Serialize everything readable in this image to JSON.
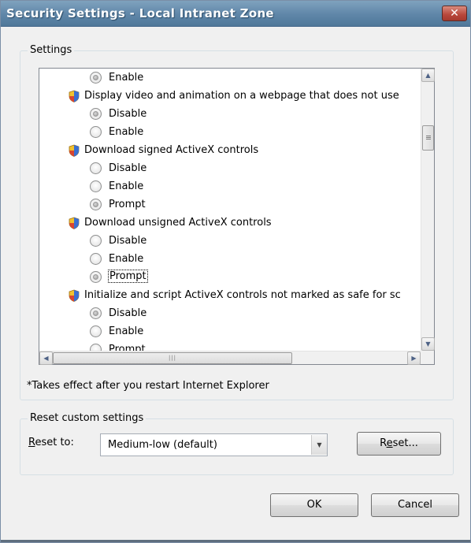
{
  "window": {
    "title": "Security Settings - Local Intranet Zone",
    "close_label": "✕"
  },
  "settings_group": {
    "legend": "Settings",
    "items": [
      {
        "kind": "option",
        "label": "Enable",
        "checked": true
      },
      {
        "kind": "header",
        "label": "Display video and animation on a webpage that does not use"
      },
      {
        "kind": "option",
        "label": "Disable",
        "checked": true
      },
      {
        "kind": "option",
        "label": "Enable",
        "checked": false
      },
      {
        "kind": "header",
        "label": "Download signed ActiveX controls"
      },
      {
        "kind": "option",
        "label": "Disable",
        "checked": false
      },
      {
        "kind": "option",
        "label": "Enable",
        "checked": false
      },
      {
        "kind": "option",
        "label": "Prompt",
        "checked": true
      },
      {
        "kind": "header",
        "label": "Download unsigned ActiveX controls"
      },
      {
        "kind": "option",
        "label": "Disable",
        "checked": false
      },
      {
        "kind": "option",
        "label": "Enable",
        "checked": false
      },
      {
        "kind": "option",
        "label": "Prompt",
        "checked": true,
        "focused": true
      },
      {
        "kind": "header",
        "label": "Initialize and script ActiveX controls not marked as safe for sc"
      },
      {
        "kind": "option",
        "label": "Disable",
        "checked": true
      },
      {
        "kind": "option",
        "label": "Enable",
        "checked": false
      },
      {
        "kind": "option",
        "label": "Prompt",
        "checked": false
      }
    ],
    "note": "*Takes effect after you restart Internet Explorer"
  },
  "reset_group": {
    "legend": "Reset custom settings",
    "reset_to_prefix": "R",
    "reset_to_rest": "eset to:",
    "dropdown_value": "Medium-low (default)",
    "reset_button_a": "R",
    "reset_button_ul": "e",
    "reset_button_b": "set..."
  },
  "footer": {
    "ok_label": "OK",
    "cancel_label": "Cancel"
  },
  "colors": {
    "titlebar": "#5f86a8",
    "window_bg": "#f0f0f0"
  },
  "icons": {
    "setting_header": "shield-icon",
    "scroll_up": "arrow-up-icon",
    "scroll_down": "arrow-down-icon",
    "scroll_left": "arrow-left-icon",
    "scroll_right": "arrow-right-icon",
    "dropdown": "chevron-down-icon"
  }
}
